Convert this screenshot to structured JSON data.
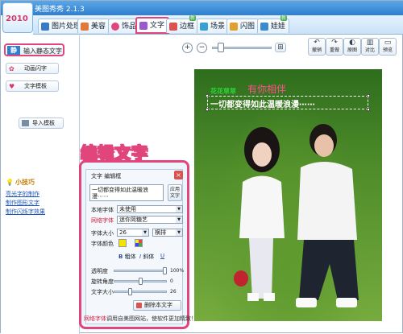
{
  "window": {
    "title": "美图秀秀 2.1.3",
    "badge_text": "2010"
  },
  "tabs": [
    {
      "label": "图片处理",
      "color": "#3a78c8"
    },
    {
      "label": "美容",
      "color": "#e07a3a"
    },
    {
      "label": "饰品",
      "color": "#e0457b"
    },
    {
      "label": "文字",
      "color": "#9b59d0",
      "active": true
    },
    {
      "label": "边框",
      "color": "#d9534f",
      "badge": "新"
    },
    {
      "label": "场景",
      "color": "#3aa0d0"
    },
    {
      "label": "闪图",
      "color": "#e0a030"
    },
    {
      "label": "娃娃",
      "color": "#3a8ad0",
      "badge": "新"
    }
  ],
  "sidebar": {
    "static_text_label": "输入静态文字",
    "static_text_icon_char": "静",
    "animated_text_label": "动画闪字",
    "text_template_label": "文字模板",
    "import_template_label": "导入模板",
    "tips_title": "小技巧",
    "tips": [
      "亮光字的制作",
      "制作图形文字",
      "制作闪烁字效果"
    ]
  },
  "toolbar": {
    "zoom_in": "+",
    "zoom_out": "−",
    "zoom_level": 0.1,
    "buttons": [
      {
        "label": "撤销",
        "icon": "undo-icon",
        "glyph": "↶"
      },
      {
        "label": "重做",
        "icon": "redo-icon",
        "glyph": "↷"
      },
      {
        "label": "原图",
        "icon": "original-icon",
        "glyph": "◐"
      },
      {
        "label": "对比",
        "icon": "compare-icon",
        "glyph": "▥"
      },
      {
        "label": "预览",
        "icon": "preview-icon",
        "glyph": "▭"
      }
    ]
  },
  "canvas": {
    "small_green_text": "花花草草",
    "pink_text": "有你相伴",
    "caption_text": "一切都变得如此温暖浪漫⋯⋯"
  },
  "callout": {
    "text": "编辑文字"
  },
  "dialog": {
    "title": "文字 编辑框",
    "textarea_value": "一切都变得如此温暖浪漫⋯⋯",
    "apply_label": "应用文字",
    "local_font_label": "本地字体",
    "local_font_value": "未使用",
    "web_font_label": "网络字体",
    "web_font_value": "迷你简糖艺",
    "font_size_label": "字体大小",
    "font_size_value": "26",
    "orientation_value": "横排",
    "font_color_label": "字体颜色",
    "bold_label": "粗体",
    "italic_label": "斜体",
    "underline_label": "U",
    "opacity_label": "透明度",
    "opacity_value": "100%",
    "opacity_level": 1.0,
    "rotation_label": "旋转角度",
    "rotation_value": "0",
    "rotation_level": 0.5,
    "text_size_label": "文字大小",
    "text_size_value": "26",
    "text_size_level": 0.3,
    "delete_label": "删除本文字",
    "footer_red": "网络字体",
    "footer_text": "调用自美图网站，使软件更加精致！",
    "accent_color": "#e0457b",
    "font_color": "#f5e400"
  }
}
